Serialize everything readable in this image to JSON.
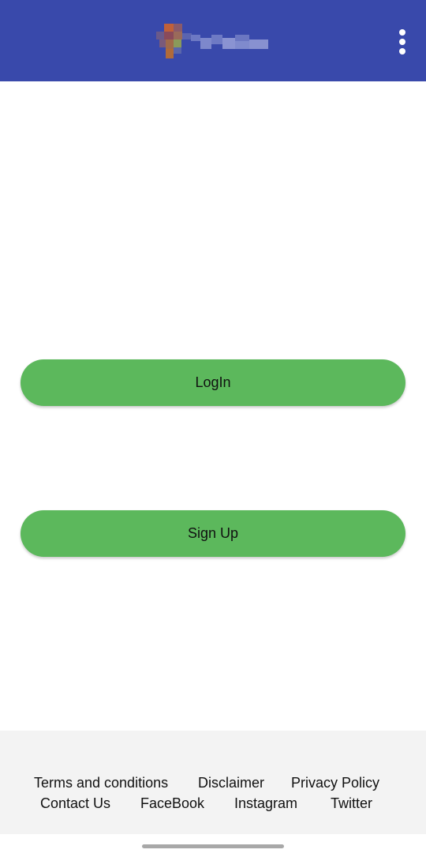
{
  "app_bar": {
    "logo_icon": "blurred-logo",
    "menu_icon": "more-vert-icon",
    "background_color": "#3949ab"
  },
  "main": {
    "login_label": "LogIn",
    "signup_label": "Sign Up",
    "button_color": "#5cb85c"
  },
  "footer": {
    "links_row1": [
      "Terms and conditions",
      "Disclaimer",
      "Privacy Policy"
    ],
    "links_row2": [
      "Contact Us",
      "FaceBook",
      "Instagram",
      "Twitter"
    ]
  }
}
